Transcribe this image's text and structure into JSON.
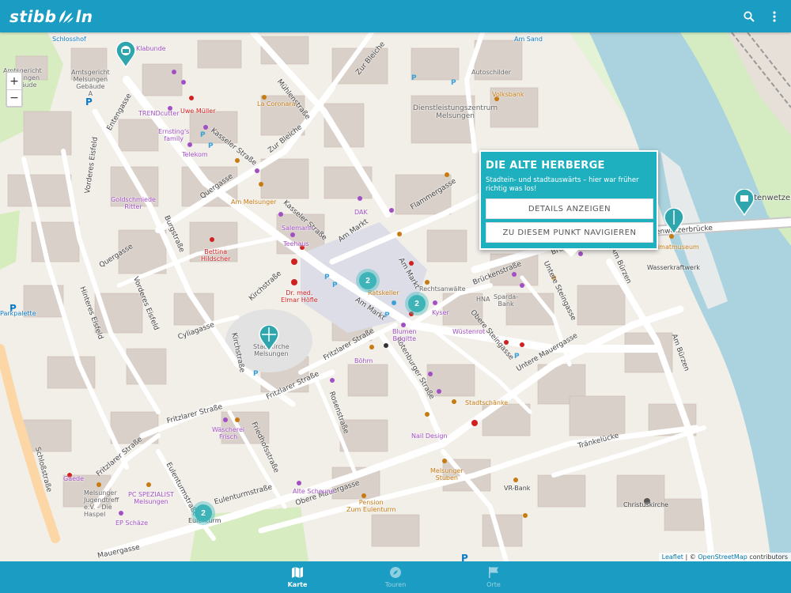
{
  "app": {
    "logo_left": "stibb",
    "logo_right": "ln",
    "search_icon": "search-icon",
    "menu_icon": "more-vert-icon",
    "brand_color": "#1b9cc2"
  },
  "map": {
    "zoom_in": "+",
    "zoom_out": "−",
    "attribution_leaflet": "Leaflet",
    "attribution_sep": " | © ",
    "attribution_osm": "OpenStreetMap",
    "attribution_suffix": " contributors",
    "streets": {
      "muehlenstrasse": "Mühlenstraße",
      "zur_bleiche_1": "Zur Bleiche",
      "zur_bleiche_2": "Zur Bleiche",
      "kasseler_strasse_1": "Kasseler Straße",
      "kasseler_strasse_2": "Kasseler Straße",
      "entengasse": "Entengasse",
      "vorderes_eisfeld_1": "Vorderes Eisfeld",
      "vorderes_eisfeld_2": "Vorderes Eisfeld",
      "hinteres_eisfeld": "Hinteres Eisfeld",
      "quergasse_1": "Quergasse",
      "quergasse_2": "Quergasse",
      "burgstrasse": "Burgstraße",
      "kirchstrasse_1": "Kirchstraße",
      "kirchstrasse_2": "Kirchstraße",
      "cyliagasse": "Cyliagasse",
      "fritzlarer_strasse_1": "Fritzlarer Straße",
      "fritzlarer_strasse_2": "Fritzlarer Straße",
      "fritzlarer_strasse_3": "Fritzlarer Straße",
      "fritzlarer_strasse_4": "Fritzlarer Straße",
      "am_markt_1": "Am Markt",
      "am_markt_2": "Am Markt",
      "am_markt_3": "Am Markt",
      "flammergasse": "Flammergasse",
      "brueckenstrasse_1": "Brückenstraße",
      "brueckenstrasse_2": "Brückenstraße",
      "untere_steingasse": "Untere Steingasse",
      "obere_steingasse": "Obere Steingasse",
      "rotenburger_strasse": "Rotenburger Straße",
      "rosenstrasse": "Rosenstraße",
      "untere_mauergasse": "Untere Mauergasse",
      "obere_mauergasse": "Obere Mauergasse",
      "eulenturmstrasse_1": "Eulenturmstraße",
      "eulenturmstrasse_2": "Eulenturmstraße",
      "friedhofsstrasse": "Friedhofsstraße",
      "schlossstrasse": "Schloßstraße",
      "am_buerzen_1": "Am Bürzen",
      "am_buerzen_2": "Am Bürzen",
      "traenkluecke": "Tränkelücke",
      "mauergasse": "Mauergasse",
      "fulda_bruecke": "Bartenwetzerbrücke",
      "fulda_bruecke_2": "Bartenwetzerbrüc"
    },
    "pois": {
      "schlosshof": "Schlosshof",
      "klabunde": "Klabunde",
      "amtsgericht": "Amtsgericht\nMelsungen\nGebäude\nA",
      "amtsgericht2": "Amtsgericht\nMelsungen\nGebäude",
      "trendcutter": "TRENDcutter",
      "uwe_mueller": "Uwe Müller",
      "ernstings": "Ernsting's\nfamily",
      "telekom": "Telekom",
      "la_coronara": "La Coronara",
      "am_sand": "Am Sand",
      "autoschilder": "Autoschilder",
      "volksbank": "Volksbank",
      "dlz": "Dienstleistungszentrum\nMelsungen",
      "goldschmiede": "Goldschmiede\nRitter",
      "am_melsunger": "Am Melsunger",
      "salemann": "Salemann",
      "teehaus": "Teehaus",
      "dak": "DAK",
      "bettina": "Bettina\nHildscher",
      "dr_hoefle": "Dr. med.\nElmar Höfle",
      "ratskeller": "Ratskeller",
      "rechtsanwalt": "Rechtsanwälte",
      "hna": "HNA",
      "sparda": "Sparda-\nBank",
      "kyser": "Kyser",
      "blumen": "Blumen\nBrigitte",
      "wuesteroth": "Wüstenrot",
      "stadtkirche": "Stadtkirche\nMelsungen",
      "boehm": "Böhm",
      "heimatmuseum": "Heimatmuseum",
      "wasserkraftwerk": "Wasserkraftwerk",
      "stadtschaenke": "Stadtschänke",
      "nail_design": "Nail Design",
      "waescherei": "Wäscherei\nFrisch",
      "parkpalette": "Parkpalette",
      "melsunger_stuben": "Melsunger\nStuben",
      "vr_bank": "VR-Bank",
      "christuskirche": "Christuskirche",
      "alte_scheune": "Alte Scheune",
      "pension": "Pension\nZum Eulenturm",
      "jugendtreff": "Melsunger\nJugendtreff\ne.V. - Die\nHaspel",
      "pc_spezialist": "PC SPEZIALIST\nMelsungen",
      "ep_schaeze": "EP Schäze",
      "eulenturm": "Eulenturm",
      "gaede": "Gaede"
    },
    "clusters": [
      {
        "count": "2"
      },
      {
        "count": "2"
      },
      {
        "count": "2"
      }
    ]
  },
  "popup": {
    "title": "DIE ALTE HERBERGE",
    "description": "Stadtein- und stadtauswärts – hier war früher richtig was los!",
    "details_button": "DETAILS ANZEIGEN",
    "navigate_button": "ZU DIESEM PUNKT NAVIGIEREN",
    "popup_color": "#1fb0c0"
  },
  "bottom_nav": {
    "items": [
      {
        "label": "Karte",
        "icon": "map-icon",
        "active": true
      },
      {
        "label": "Touren",
        "icon": "compass-icon",
        "active": false
      },
      {
        "label": "Orte",
        "icon": "flag-icon",
        "active": false
      }
    ]
  }
}
